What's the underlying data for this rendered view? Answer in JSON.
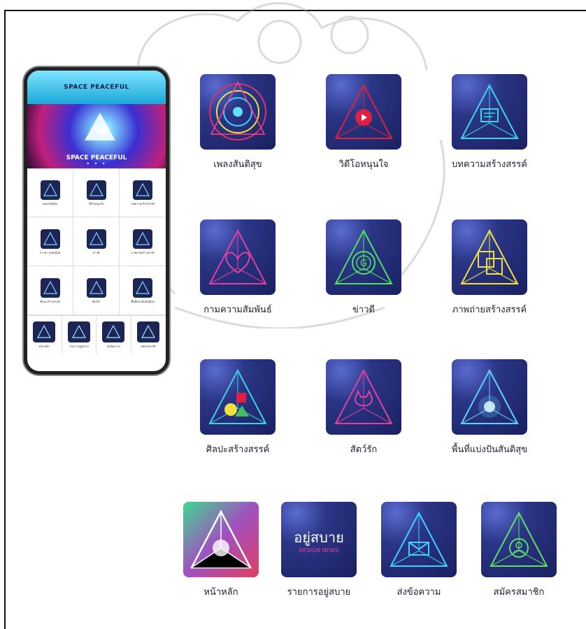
{
  "phone": {
    "header_title": "SPACE PEACEFUL",
    "banner_title": "SPACE PEACEFUL",
    "dots": "• • •",
    "grid_items": [
      {
        "label": "เพลงสันติสุข",
        "icon": "music-icon"
      },
      {
        "label": "วิดีโอหนุนใจ",
        "icon": "video-icon"
      },
      {
        "label": "บทความสร้างสรรค์",
        "icon": "article-icon"
      },
      {
        "label": "การความสัมพันธ์",
        "icon": "relationship-icon"
      },
      {
        "label": "ข่าวดี",
        "icon": "good-news-icon"
      },
      {
        "label": "ภาพถ่ายสร้างสรรค์",
        "icon": "photo-icon"
      },
      {
        "label": "ศิลปะสร้างสรรค์",
        "icon": "art-icon"
      },
      {
        "label": "สัตว์รัก",
        "icon": "pet-icon"
      },
      {
        "label": "พื้นที่แบ่งปันสันติสุข",
        "icon": "share-space-icon"
      }
    ],
    "bottom_items": [
      {
        "label": "หน้าหลัก",
        "icon": "home-icon"
      },
      {
        "label": "รายการอยู่สบาย",
        "icon": "program-icon"
      },
      {
        "label": "ส่งข้อความ",
        "icon": "message-icon"
      },
      {
        "label": "สมัครสมาชิก",
        "icon": "member-icon"
      }
    ]
  },
  "apps": [
    {
      "label": "เพลงสันติสุข",
      "icon": "music-icon",
      "accent": "#e0306a"
    },
    {
      "label": "วิดีโอหนุนใจ",
      "icon": "video-icon",
      "accent": "#e02040"
    },
    {
      "label": "บทความสร้างสรรค์",
      "icon": "article-icon",
      "accent": "#3fd4e8"
    },
    {
      "label": "กามความสัมพันธ์",
      "icon": "relationship-icon",
      "accent": "#e040a0"
    },
    {
      "label": "ข่าวดี",
      "icon": "good-news-icon",
      "accent": "#50e060"
    },
    {
      "label": "ภาพถ่ายสร้างสรรค์",
      "icon": "photo-icon",
      "accent": "#f0e040"
    },
    {
      "label": "ศิลปะสร้างสรรค์",
      "icon": "art-icon",
      "accent": "#40d0e0"
    },
    {
      "label": "สัตว์รัก",
      "icon": "pet-icon",
      "accent": "#e040a0"
    },
    {
      "label": "พื้นที่แบ่งปันสันติสุข",
      "icon": "share-space-icon",
      "accent": "#60d0ff"
    },
    {
      "label": "หน้าหลัก",
      "icon": "home-icon",
      "accent": "#ffffff"
    },
    {
      "label": "รายการอยู่สบาย",
      "icon": "program-icon",
      "accent": "#ffffff",
      "logo_text": "อยู่สบาย",
      "logo_sub": "DESIGN NEWS"
    },
    {
      "label": "ส่งข้อความ",
      "icon": "message-icon",
      "accent": "#40d0ff"
    },
    {
      "label": "สมัครสมาชิก",
      "icon": "member-icon",
      "accent": "#60e060"
    }
  ]
}
